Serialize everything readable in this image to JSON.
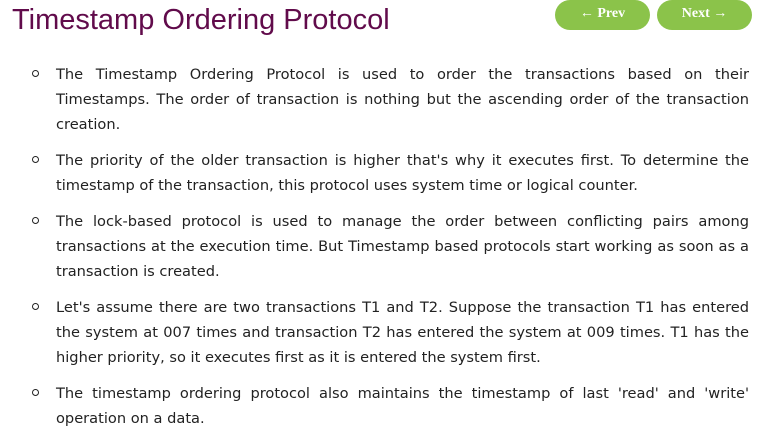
{
  "page": {
    "title": "Timestamp Ordering Protocol"
  },
  "nav": {
    "prev_label": "← Prev",
    "next_label": "Next →"
  },
  "content": {
    "items": [
      {
        "text": "The Timestamp Ordering Protocol is used to order the transactions based on their Timestamps. The order of transaction is nothing but the ascending order of the transaction creation."
      },
      {
        "text": "The priority of the older transaction is higher that's why it executes first. To determine the timestamp of the transaction, this protocol uses system time or logical counter."
      },
      {
        "text": "The lock-based protocol is used to manage the order between conflicting pairs among transactions at the execution time. But Timestamp based protocols start working as soon as a transaction is created."
      },
      {
        "text": "Let's assume there are two transactions T1 and T2. Suppose the transaction T1 has entered the system at 007 times and transaction T2 has entered the system at 009 times. T1 has the higher priority, so it executes first as it is entered the system first."
      },
      {
        "text": "The timestamp ordering protocol also maintains the timestamp of last 'read' and 'write' operation on a data."
      }
    ]
  },
  "colors": {
    "title": "#610b4b",
    "nav_button": "#8bc34a",
    "body_text": "#222222"
  }
}
